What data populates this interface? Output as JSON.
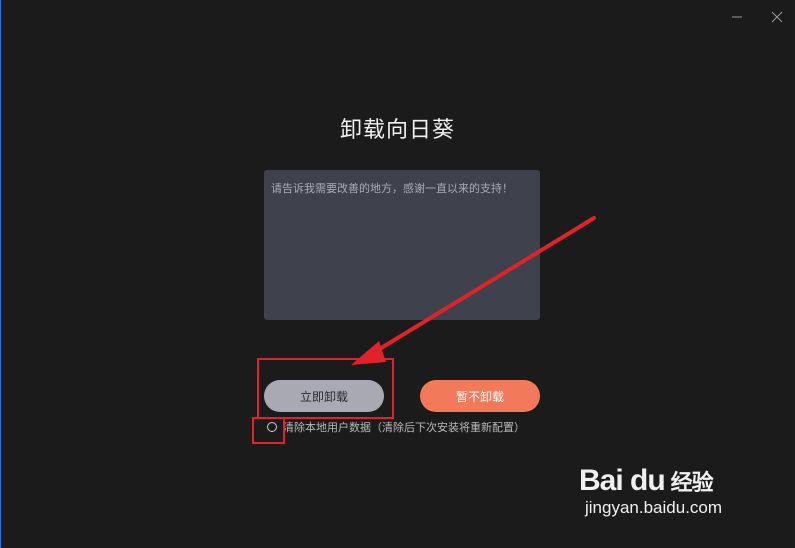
{
  "window": {
    "minimize_icon": "minimize-icon",
    "close_icon": "close-icon"
  },
  "title": "卸载向日葵",
  "feedback": {
    "placeholder": "请告诉我需要改善的地方，感谢一直以来的支持！",
    "value": ""
  },
  "buttons": {
    "uninstall_label": "立即卸载",
    "keep_label": "暂不卸载"
  },
  "option": {
    "label": "清除本地用户数据（清除后下次安装将重新配置）",
    "checked": false
  },
  "watermark": {
    "brand": "Bai du",
    "product": "经验",
    "url": "jingyan.baidu.com"
  },
  "colors": {
    "background": "#1b1b1c",
    "textarea": "#3f424d",
    "uninstall_button": "#a9a9b3",
    "keep_button": "#f2795a",
    "annotation_red": "#e0222a"
  }
}
